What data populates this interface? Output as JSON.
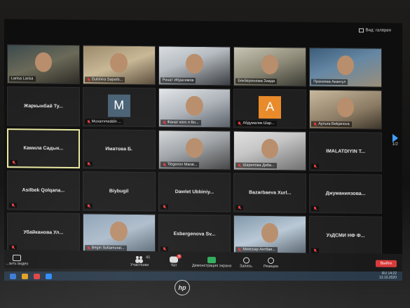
{
  "top_bar": {
    "view_label": "Вид: галерея"
  },
  "tiles": [
    {
      "name": "Larisa Larisa",
      "video": "v1",
      "muted": false
    },
    {
      "name": "Gulshira Saparb...",
      "video": "v2",
      "muted": true
    },
    {
      "name": "Ринат Ибрагимов",
      "video": "v3",
      "muted": false
    },
    {
      "name": "Бекбергенова Зиада",
      "video": "v4",
      "muted": false
    },
    {
      "name": "Прекеева Акангул",
      "video": "v5",
      "muted": false
    },
    {
      "name": "Жаркынбай Ту...",
      "video": null,
      "muted": false
    },
    {
      "name": "Muxammeddin ...",
      "video": null,
      "muted": true,
      "avatar_letter": "M",
      "avatar_color": "#4a6275"
    },
    {
      "name": "Фанат кого я Во...",
      "video": "v6",
      "muted": true
    },
    {
      "name": "Абдумалик Шар...",
      "video": null,
      "muted": true,
      "avatar_letter": "A",
      "avatar_color": "#e98b2a"
    },
    {
      "name": "Aynura Bekjanova",
      "video": "v7",
      "muted": true
    },
    {
      "name": "Камила Садык...",
      "video": null,
      "muted": true,
      "active": true
    },
    {
      "name": "Иматова Б.",
      "video": null,
      "muted": true
    },
    {
      "name": "Tlegenov Marat...",
      "video": "v8",
      "muted": true
    },
    {
      "name": "Шарипова Диба...",
      "video": "v9",
      "muted": true
    },
    {
      "name": "IMALATDIYIN T...",
      "video": null,
      "muted": true
    },
    {
      "name": "Asilbek Qolqana...",
      "video": null,
      "muted": true
    },
    {
      "name": "Biybugil",
      "video": null,
      "muted": true
    },
    {
      "name": "Dawlet Ubbiniy...",
      "video": null,
      "muted": true
    },
    {
      "name": "Bazarbaeva Xurl...",
      "video": null,
      "muted": true
    },
    {
      "name": "Джуманиязова...",
      "video": null,
      "muted": true
    },
    {
      "name": "Убайканова Ул...",
      "video": null,
      "muted": true
    },
    {
      "name": "Begin Sultamurat...",
      "video": "v10",
      "muted": true
    },
    {
      "name": "Esbergenova Sv...",
      "video": null,
      "muted": true
    },
    {
      "name": "Мияссар Аятбае...",
      "video": "v11",
      "muted": true
    },
    {
      "name": "УзДСМИ НФ Ф...",
      "video": null,
      "muted": true
    }
  ],
  "pager": {
    "label": "1/2"
  },
  "toolbar": {
    "start_video": "...зить видео",
    "participants": "Участники",
    "participants_count": "41",
    "chat": "Чат",
    "chat_badge": "9",
    "share": "Демонстрация экрана",
    "record": "Запись",
    "reactions": "Реакции",
    "leave": "Выйти"
  },
  "taskbar": {
    "lang": "RU",
    "time": "14:22",
    "date": "13.10.2020"
  },
  "laptop": {
    "brand": "hp"
  }
}
